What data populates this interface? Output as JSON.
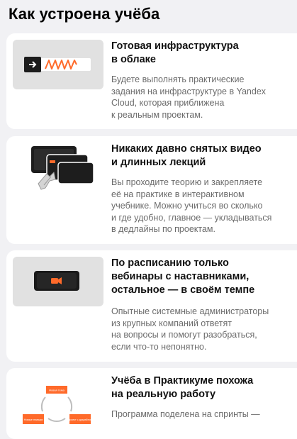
{
  "page": {
    "title": "Как устроена учёба"
  },
  "cards": [
    {
      "title": [
        "Готовая инфраструктура",
        "в облаке"
      ],
      "text": [
        "Будете выполнять практические",
        "задания на инфраструктуре в Yandex",
        "Cloud, которая приближена",
        "к реальным проектам."
      ],
      "icon": "infrastructure-illustration"
    },
    {
      "title": [
        "Никаких давно снятых видео",
        "и длинных лекций"
      ],
      "text": [
        "Вы проходите теорию и закрепляете",
        "её на практике в интерактивном",
        "учебнике. Можно учиться во сколько",
        "и где удобно, главное — укладываться",
        "в дедлайны по проектам."
      ],
      "icon": "interactive-textbook-illustration"
    },
    {
      "title": [
        "По расписанию только",
        "вебинары с наставниками,",
        "остальное — в своём темпе"
      ],
      "text": [
        "Опытные системные администраторы",
        "из крупных компаний ответят",
        "на вопросы и помогут разобраться,",
        "если что-то непонятно."
      ],
      "icon": "webinar-camera-illustration"
    },
    {
      "title": [
        "Учёба в Практикуме похожа",
        "на реальную работу"
      ],
      "text": [
        "Программа поделена на спринты —"
      ],
      "icon": "sprint-cycle-illustration",
      "cycle_labels": [
        "Новая тема",
        "Новые навыки",
        "Проект с дедлайном"
      ]
    }
  ],
  "colors": {
    "accent": "#ff6a2a",
    "card_bg": "#ffffff",
    "page_bg": "#f1f1f4",
    "text_muted": "#6b6b6b"
  }
}
